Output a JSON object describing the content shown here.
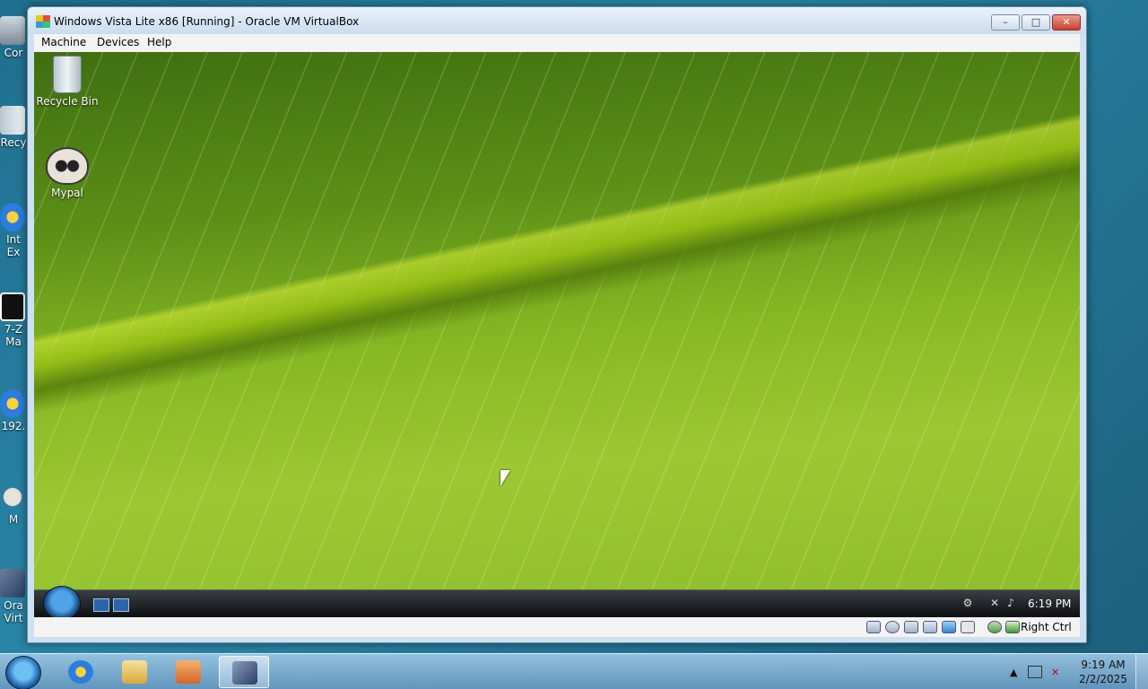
{
  "host_desktop": {
    "icons": [
      {
        "label": "Cor"
      },
      {
        "label": "Recy"
      },
      {
        "label": "Int Ex"
      },
      {
        "label": "7-Z Ma"
      },
      {
        "label": "192."
      },
      {
        "label": "M"
      },
      {
        "label": "Ora Virt"
      }
    ]
  },
  "vbox": {
    "title": "Windows Vista Lite x86 [Running] - Oracle VM VirtualBox",
    "buttons": {
      "minimize": "–",
      "maximize": "□",
      "close": "✕"
    },
    "menu": [
      "Machine",
      "Devices",
      "Help"
    ],
    "statusbar": {
      "host_key": "Right Ctrl"
    }
  },
  "guest": {
    "desktop_icons": [
      {
        "label": "Recycle Bin",
        "icon": "recycle-bin-icon"
      },
      {
        "label": "Mypal",
        "icon": "mypal-icon"
      }
    ],
    "taskbar": {
      "clock": "6:19 PM"
    }
  },
  "host_taskbar": {
    "pinned": [
      "internet-explorer-icon",
      "file-explorer-icon",
      "media-player-icon",
      "virtualbox-icon"
    ],
    "clock_time": "9:19 AM",
    "clock_date": "2/2/2025",
    "tray_arrow": "▲"
  },
  "colors": {
    "guest_wallpaper": "#86b824",
    "host_taskbar": "#7aaed4"
  }
}
